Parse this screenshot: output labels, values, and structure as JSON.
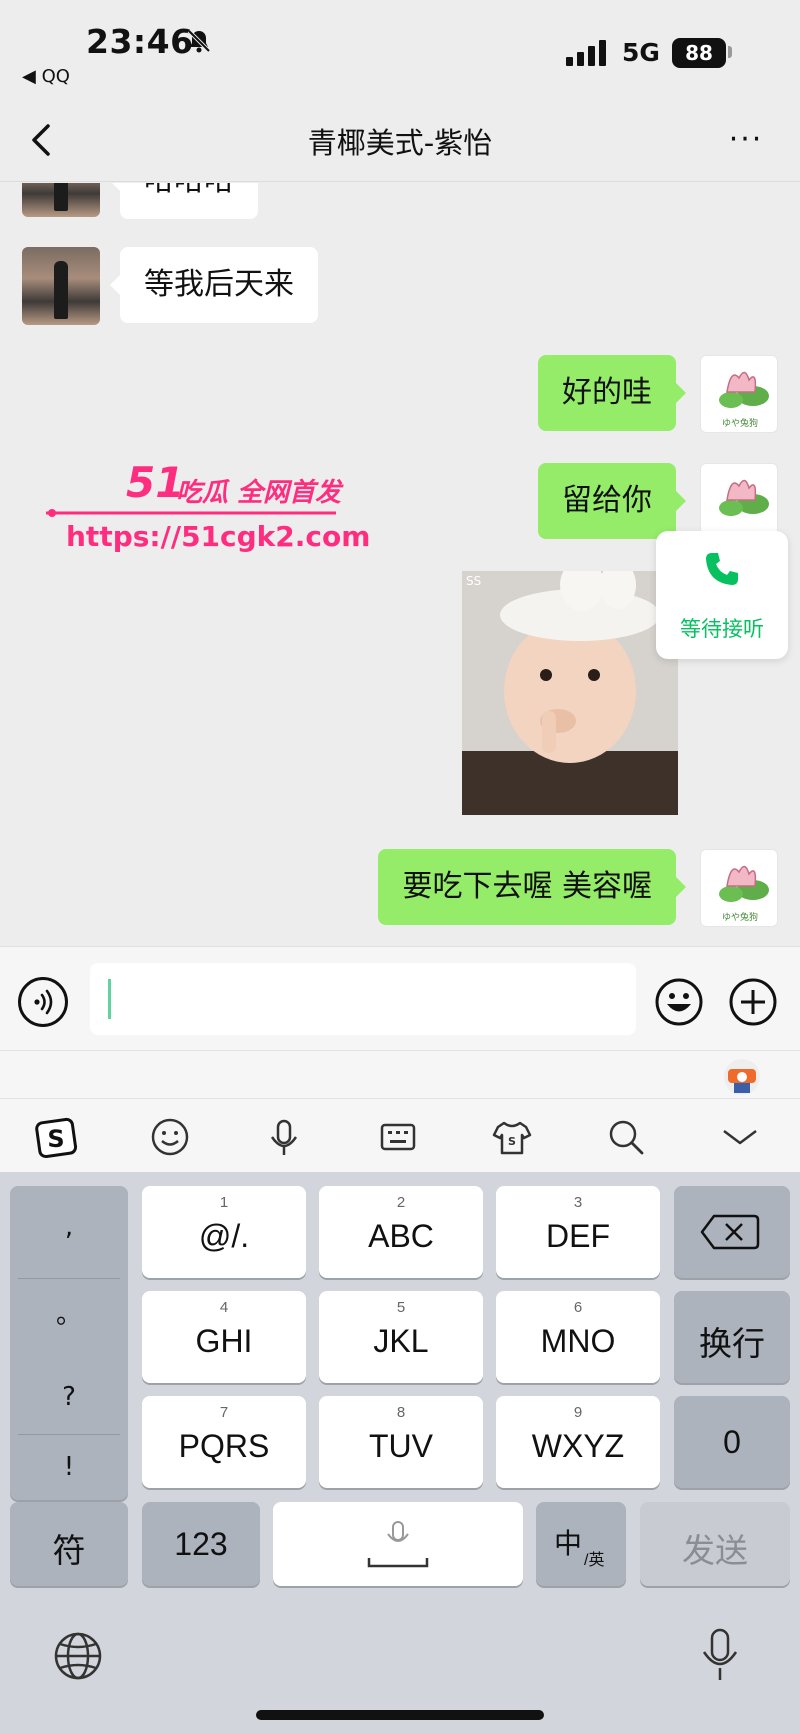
{
  "status_bar": {
    "time": "23:46",
    "back_app": "◀ QQ",
    "network": "5G",
    "battery": "88"
  },
  "header": {
    "title": "青椰美式-紫怡",
    "more": "···"
  },
  "messages": [
    {
      "from": "other",
      "text": "哈哈哈"
    },
    {
      "from": "other",
      "text": "等我后天来"
    },
    {
      "from": "me",
      "text": "好的哇"
    },
    {
      "from": "me",
      "text": "留给你"
    },
    {
      "from": "me",
      "type": "sticker",
      "caption": "SS"
    },
    {
      "from": "me",
      "text": "要吃下去喔  美容喔"
    }
  ],
  "watermark": {
    "brand": "51",
    "tag": "吃瓜 全网首发",
    "url": "https://51cgk2.com"
  },
  "call_card": {
    "label": "等待接听"
  },
  "avatar_me_caption": "ゆや兔狗",
  "keyboard": {
    "punct": [
      ",",
      "。",
      "?",
      "!"
    ],
    "keys": [
      {
        "num": "1",
        "label": "@/."
      },
      {
        "num": "2",
        "label": "ABC"
      },
      {
        "num": "3",
        "label": "DEF"
      },
      {
        "num": "4",
        "label": "GHI"
      },
      {
        "num": "5",
        "label": "JKL"
      },
      {
        "num": "6",
        "label": "MNO"
      },
      {
        "num": "7",
        "label": "PQRS"
      },
      {
        "num": "8",
        "label": "TUV"
      },
      {
        "num": "9",
        "label": "WXYZ"
      }
    ],
    "enter": "换行",
    "zero": "0",
    "symbols": "符",
    "numbers": "123",
    "lang_main": "中",
    "lang_sub": "/英",
    "send": "发送"
  },
  "colors": {
    "bubble_me": "#95ec69",
    "accent_green": "#07c160",
    "watermark": "#ff2d7f"
  }
}
